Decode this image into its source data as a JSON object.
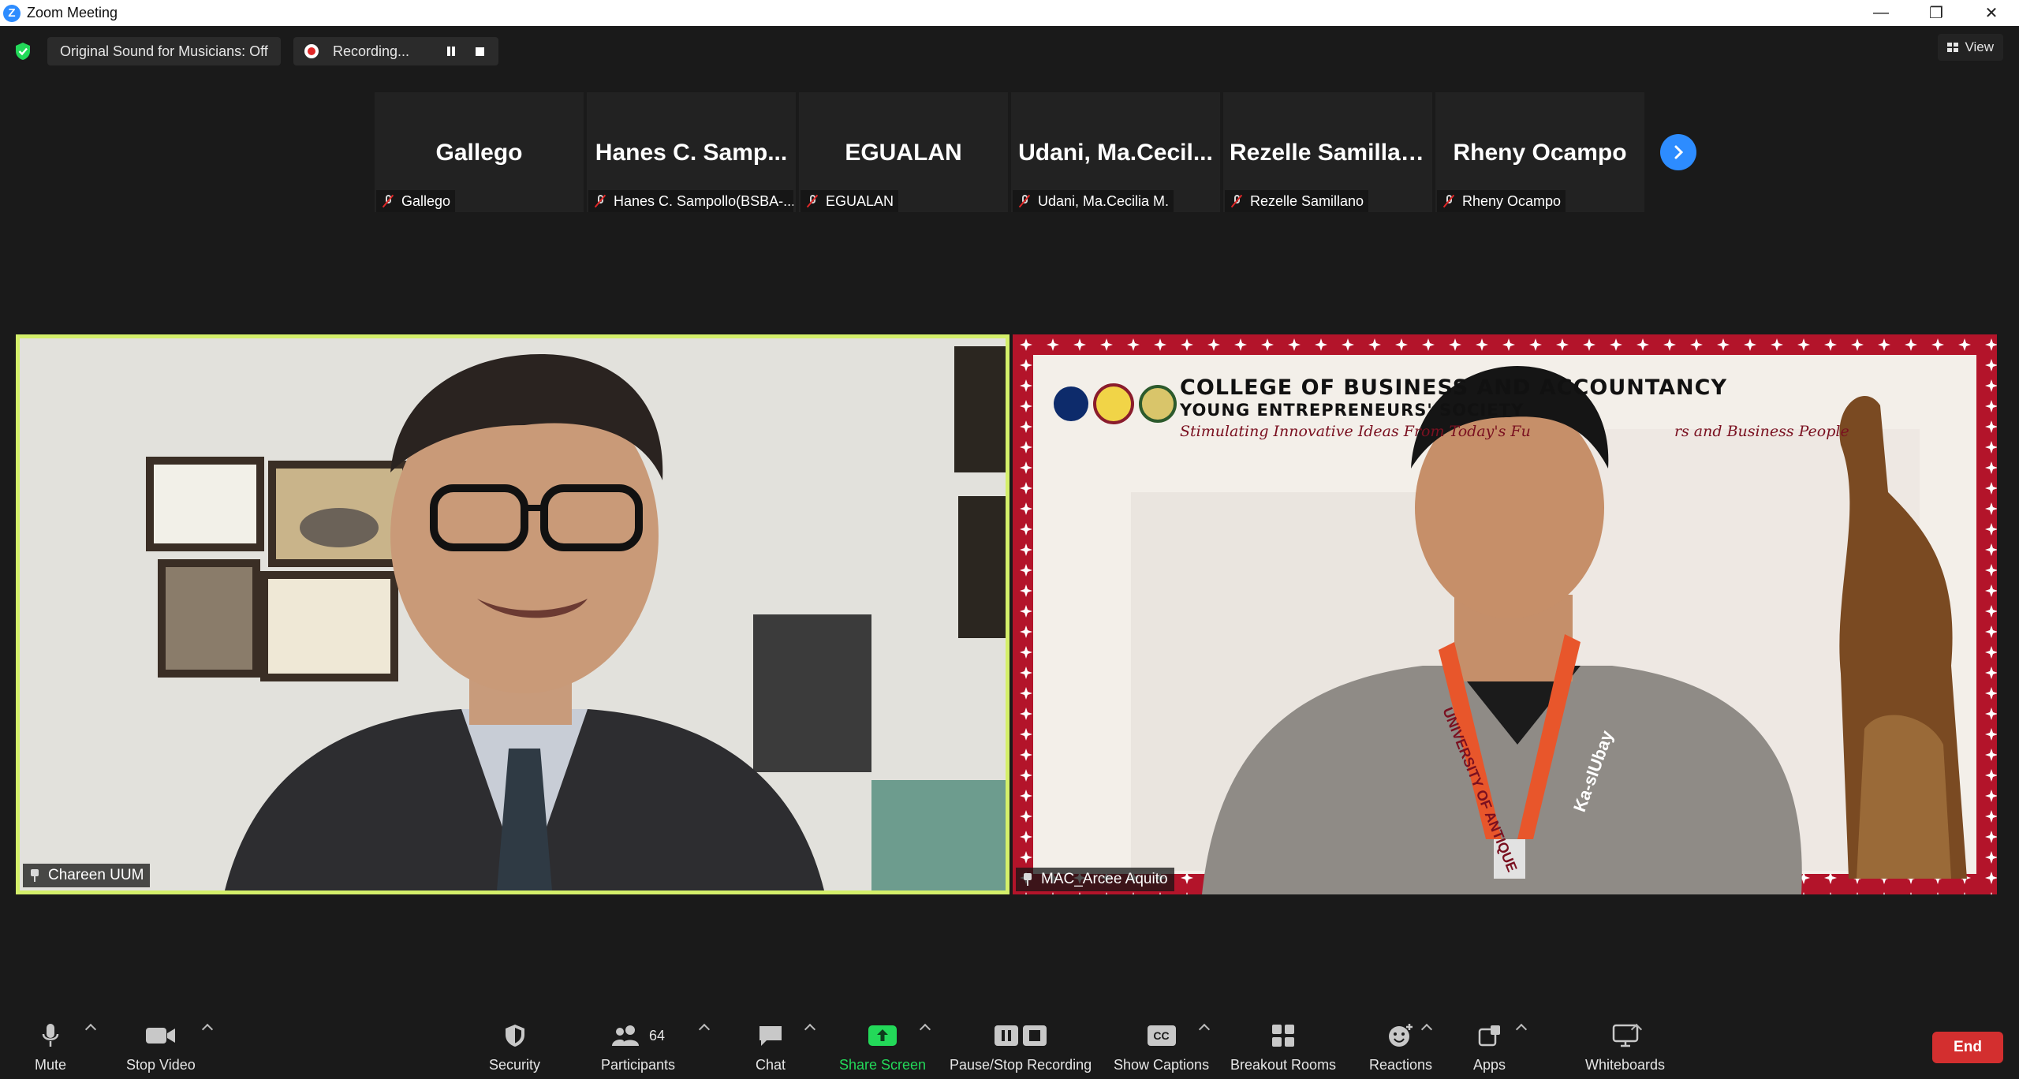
{
  "window": {
    "title": "Zoom Meeting",
    "minimize": "—",
    "restore": "❐",
    "close": "✕"
  },
  "topbar": {
    "sound_label": "Original Sound for Musicians: Off",
    "recording_label": "Recording...",
    "view_label": "View"
  },
  "participants_strip": [
    {
      "display": "Gallego",
      "name": "Gallego"
    },
    {
      "display": "Hanes  C.  Samp...",
      "name": "Hanes C. Sampollo(BSBA-..."
    },
    {
      "display": "EGUALAN",
      "name": "EGUALAN"
    },
    {
      "display": "Udani,  Ma.Cecil...",
      "name": "Udani, Ma.Cecilia M."
    },
    {
      "display": "Rezelle Samillano",
      "name": "Rezelle Samillano"
    },
    {
      "display": "Rheny Ocampo",
      "name": "Rheny Ocampo"
    }
  ],
  "videos": {
    "left_name": "Chareen UUM",
    "right_name": "MAC_Arcee Aquito",
    "banner_title": "COLLEGE OF BUSINESS AND ACCOUNTANCY",
    "banner_subtitle": "YOUNG ENTREPRENEURS' SOCIETY",
    "banner_tagline": "Stimulating Innovative Ideas From Today's Fu",
    "banner_tagline_end": "rs and Business People",
    "lanyard_text": "UNIVERSITY OF ANTIQUE",
    "lanyard_text2": "Ka-sIUbay"
  },
  "toolbar": {
    "mute": "Mute",
    "stop_video": "Stop Video",
    "security": "Security",
    "participants": "Participants",
    "participants_count": "64",
    "chat": "Chat",
    "share_screen": "Share Screen",
    "pause_stop_recording": "Pause/Stop Recording",
    "show_captions": "Show Captions",
    "captions_icon_text": "CC",
    "breakout_rooms": "Breakout Rooms",
    "reactions": "Reactions",
    "apps": "Apps",
    "whiteboards": "Whiteboards",
    "end": "End"
  },
  "colors": {
    "active_speaker_border": "#d4ef6a",
    "share_green": "#23d959",
    "end_red": "#d32f2f",
    "accent_blue": "#2d8cff",
    "banner_red": "#b3142a"
  }
}
